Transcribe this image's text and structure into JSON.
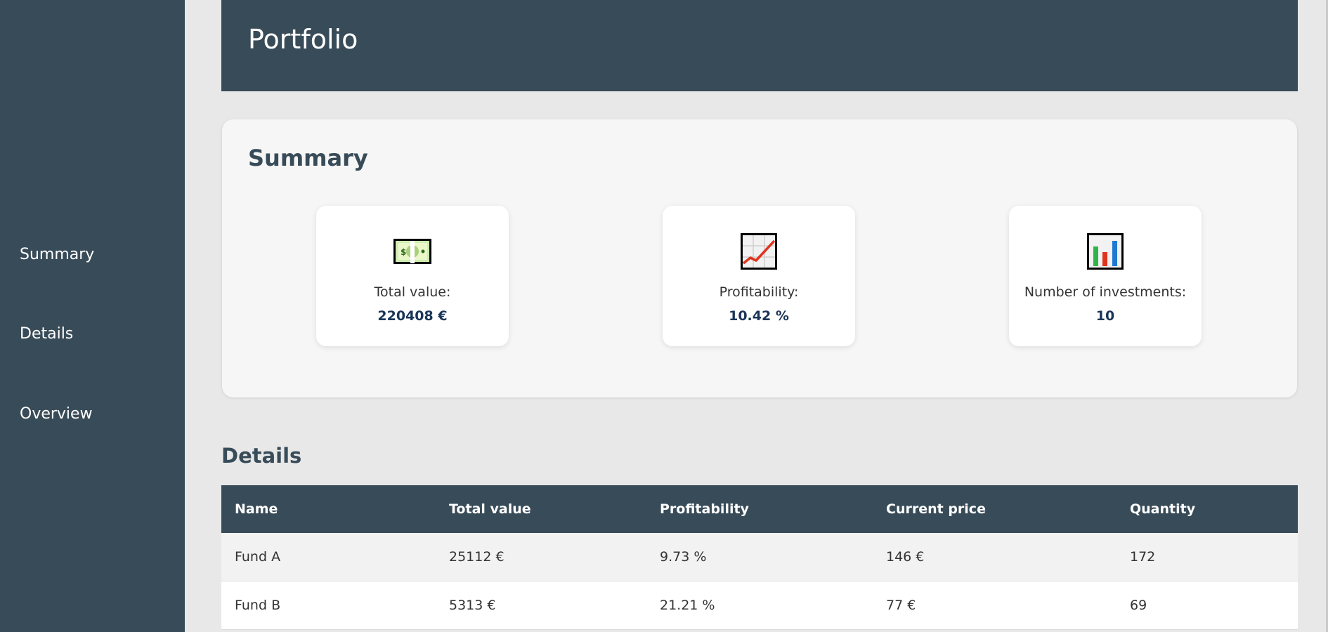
{
  "sidebar": {
    "items": [
      {
        "label": "Summary"
      },
      {
        "label": "Details"
      },
      {
        "label": "Overview"
      }
    ]
  },
  "header": {
    "title": "Portfolio"
  },
  "summary": {
    "title": "Summary",
    "cards": [
      {
        "icon": "cash-icon",
        "label": "Total value:",
        "value": "220408 €"
      },
      {
        "icon": "line-chart-icon",
        "label": "Profitability:",
        "value": "10.42 %"
      },
      {
        "icon": "bar-chart-icon",
        "label": "Number of investments:",
        "value": "10"
      }
    ]
  },
  "details": {
    "title": "Details",
    "columns": [
      "Name",
      "Total value",
      "Profitability",
      "Current price",
      "Quantity"
    ],
    "rows": [
      [
        "Fund A",
        "25112 €",
        "9.73 %",
        "146 €",
        "172"
      ],
      [
        "Fund B",
        "5313 €",
        "21.21 %",
        "77 €",
        "69"
      ]
    ]
  },
  "colors": {
    "sidebar_bg": "#384b58",
    "header_bg": "#384b58",
    "value_text": "#1a3558"
  }
}
